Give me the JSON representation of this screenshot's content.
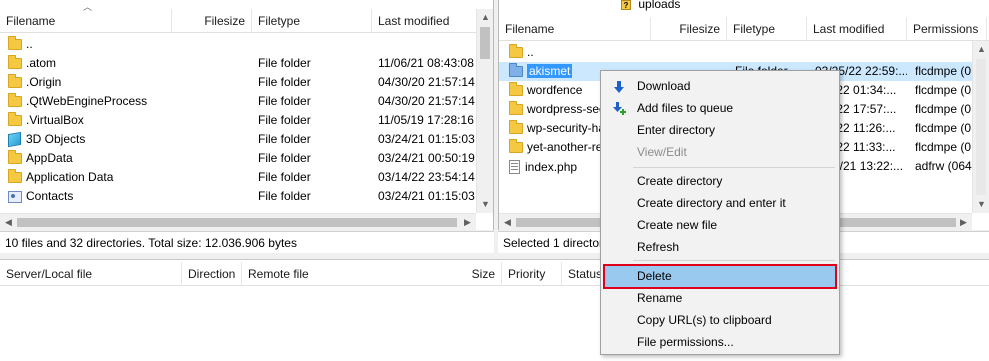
{
  "local": {
    "columns": {
      "filename": "Filename",
      "filesize": "Filesize",
      "filetype": "Filetype",
      "modified": "Last modified"
    },
    "rows": [
      {
        "name": "..",
        "type": "",
        "modified": "",
        "icon": "folder-icon"
      },
      {
        "name": ".atom",
        "type": "File folder",
        "modified": "11/06/21 08:43:08",
        "icon": "folder-icon"
      },
      {
        "name": ".Origin",
        "type": "File folder",
        "modified": "04/30/20 21:57:14",
        "icon": "folder-icon"
      },
      {
        "name": ".QtWebEngineProcess",
        "type": "File folder",
        "modified": "04/30/20 21:57:14",
        "icon": "folder-icon"
      },
      {
        "name": ".VirtualBox",
        "type": "File folder",
        "modified": "11/05/19 17:28:16",
        "icon": "folder-icon"
      },
      {
        "name": "3D Objects",
        "type": "File folder",
        "modified": "03/24/21 01:15:03",
        "icon": "cube-icon"
      },
      {
        "name": "AppData",
        "type": "File folder",
        "modified": "03/24/21 00:50:19",
        "icon": "folder-icon"
      },
      {
        "name": "Application Data",
        "type": "File folder",
        "modified": "03/14/22 23:54:14",
        "icon": "folder-icon"
      },
      {
        "name": "Contacts",
        "type": "File folder",
        "modified": "03/24/21 01:15:03",
        "icon": "contacts-icon"
      }
    ],
    "status": "10 files and 32 directories. Total size: 12.036.906 bytes"
  },
  "remote": {
    "tree_item": "uploads",
    "columns": {
      "filename": "Filename",
      "filesize": "Filesize",
      "filetype": "Filetype",
      "modified": "Last modified",
      "permissions": "Permissions"
    },
    "rows": [
      {
        "name": "..",
        "type": "",
        "modified": "",
        "perms": "",
        "icon": "folder-icon"
      },
      {
        "name": "akismet",
        "type": "File folder",
        "modified": "03/25/22 22:59:...",
        "perms": "flcdmpe (0...",
        "icon": "folder-icon"
      },
      {
        "name": "wordfence",
        "type": "",
        "modified": "/22 01:34:...",
        "perms": "flcdmpe (0...",
        "icon": "folder-icon"
      },
      {
        "name": "wordpress-seo",
        "type": "",
        "modified": "/22 17:57:...",
        "perms": "flcdmpe (0...",
        "icon": "folder-icon"
      },
      {
        "name": "wp-security-ha",
        "type": "",
        "modified": "/22 11:26:...",
        "perms": "flcdmpe (0...",
        "icon": "folder-icon"
      },
      {
        "name": "yet-another-re",
        "type": "",
        "modified": "/22 11:33:...",
        "perms": "flcdmpe (0...",
        "icon": "folder-icon"
      },
      {
        "name": "index.php",
        "type": "",
        "modified": "4/21 13:22:...",
        "perms": "adfrw (0644)",
        "icon": "php-icon"
      }
    ],
    "status": "Selected 1 director"
  },
  "queue": {
    "columns": {
      "server": "Server/Local file",
      "direction": "Direction",
      "remote": "Remote file",
      "size": "Size",
      "priority": "Priority",
      "status": "Status"
    }
  },
  "context_menu": {
    "items": [
      {
        "label": "Download",
        "icon": "download-arrow-icon",
        "disabled": false
      },
      {
        "label": "Add files to queue",
        "icon": "add-to-queue-icon",
        "disabled": false
      },
      {
        "label": "Enter directory",
        "disabled": false
      },
      {
        "label": "View/Edit",
        "disabled": true
      },
      {
        "label": "Create directory",
        "disabled": false
      },
      {
        "label": "Create directory and enter it",
        "disabled": false
      },
      {
        "label": "Create new file",
        "disabled": false
      },
      {
        "label": "Refresh",
        "disabled": false
      },
      {
        "label": "Delete",
        "disabled": false,
        "highlighted": true
      },
      {
        "label": "Rename",
        "disabled": false
      },
      {
        "label": "Copy URL(s) to clipboard",
        "disabled": false
      },
      {
        "label": "File permissions...",
        "disabled": false
      }
    ]
  },
  "colors": {
    "selection": "#3399ff",
    "highlight_border": "#e0001c",
    "menu_highlight": "#99c9ef"
  }
}
